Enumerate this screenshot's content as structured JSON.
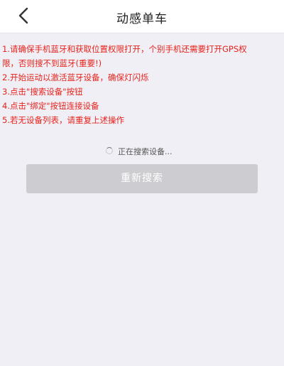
{
  "header": {
    "title": "动感单车",
    "back_icon": "chevron-left-icon"
  },
  "instructions": {
    "color": "#e8231c",
    "step1_line1": "1.请确保手机蓝牙和获取位置权限打开，个别手机还需要打开GPS权",
    "step1_line2": "限，否则搜不到蓝牙(重要!)",
    "step2": "2.开始运动以激活蓝牙设备，确保灯闪烁",
    "step3": "3.点击\"搜索设备\"按钮",
    "step4": "4.点击\"绑定\"按钮连接设备",
    "step5": "5.若无设备列表，请重复上述操作"
  },
  "status": {
    "icon": "loading-spinner-icon",
    "text": "正在搜索设备..."
  },
  "rescan_button": {
    "label": "重新搜索",
    "color": "#cdcdd1"
  }
}
